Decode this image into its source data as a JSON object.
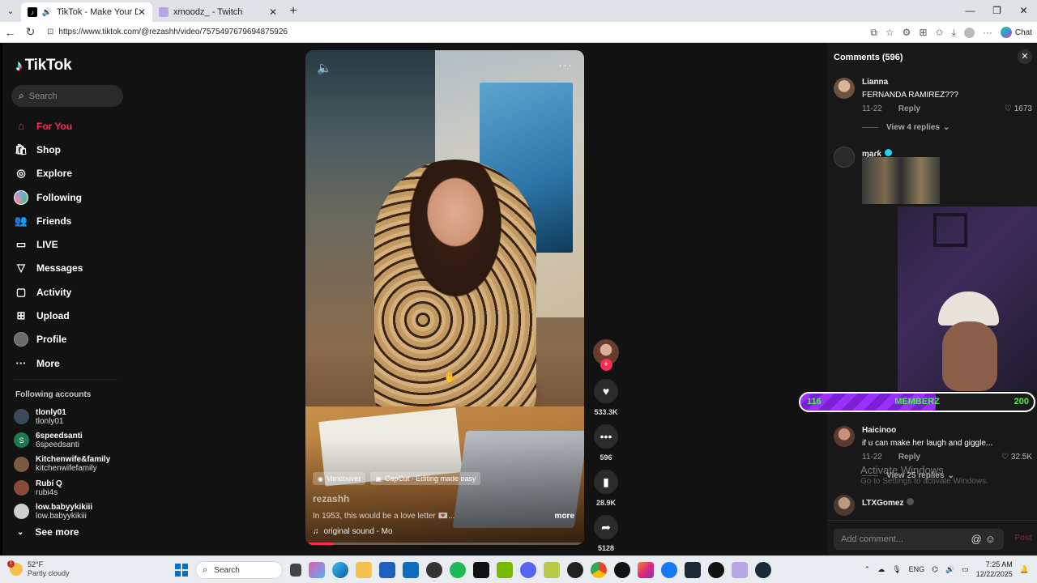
{
  "browser": {
    "tabs": [
      {
        "title": "TikTok - Make Your Day",
        "active": true
      },
      {
        "title": "xmoodz_ - Twitch",
        "active": false
      }
    ],
    "url": "https://www.tiktok.com/@rezashh/video/7575497679694875926",
    "chat_label": "Chat"
  },
  "sidebar": {
    "logo": "TikTok",
    "search_placeholder": "Search",
    "nav": [
      {
        "label": "For You",
        "icon": "home-icon",
        "active": true
      },
      {
        "label": "Shop",
        "icon": "shop-icon"
      },
      {
        "label": "Explore",
        "icon": "compass-icon"
      },
      {
        "label": "Following",
        "icon": "following-avatar-icon"
      },
      {
        "label": "Friends",
        "icon": "friends-icon"
      },
      {
        "label": "LIVE",
        "icon": "live-icon"
      },
      {
        "label": "Messages",
        "icon": "messages-icon"
      },
      {
        "label": "Activity",
        "icon": "activity-icon"
      },
      {
        "label": "Upload",
        "icon": "upload-icon"
      },
      {
        "label": "Profile",
        "icon": "profile-avatar-icon"
      },
      {
        "label": "More",
        "icon": "more-icon"
      }
    ],
    "following_title": "Following accounts",
    "following": [
      {
        "name": "tlonly01",
        "handle": "tlonly01",
        "color": "#3b4a5a"
      },
      {
        "name": "6speedsanti",
        "handle": "6speedsanti",
        "color": "#1f7a4d",
        "initial": "S"
      },
      {
        "name": "Kitchenwife&family",
        "handle": "kitchenwifefamily",
        "color": "#7a5a44"
      },
      {
        "name": "Rubí Q",
        "handle": "rubi4s",
        "color": "#8a4a3a"
      },
      {
        "name": "low.babyykikiii",
        "handle": "low.babyykikiii",
        "color": "#cfcfcf"
      }
    ],
    "see_more": "See more"
  },
  "video": {
    "tags": [
      "Vancouver",
      "CapCut · Editing made easy"
    ],
    "username": "rezashh",
    "caption": "In 1953, this would be a love letter 💌...",
    "more_label": "more",
    "sound": "original sound - Mo",
    "progress": 0.1
  },
  "actions": {
    "likes": "533.3K",
    "comments": "596",
    "saves": "28.9K",
    "shares": "5128"
  },
  "comments": {
    "header": "Comments (596)",
    "items": [
      {
        "name": "Lianna",
        "text": "FERNANDA RAMIREZ???",
        "date": "11-22",
        "reply": "Reply",
        "likes": "1673",
        "replies": "View 4 replies"
      },
      {
        "name": "ɱąɾƙ",
        "verified": true
      },
      {
        "name": "Haicinoo",
        "text": "if u can make her laugh and giggle...",
        "date": "11-22",
        "reply": "Reply",
        "likes": "32.5K",
        "replies": "View 25 replies"
      },
      {
        "name": "LTXGomez"
      }
    ],
    "input_placeholder": "Add comment...",
    "post_label": "Post"
  },
  "overlay": {
    "goal_left": "116",
    "goal_label": "MEMBERZ",
    "goal_right": "200",
    "goal_progress": 0.58,
    "watermark_title": "Activate Windows",
    "watermark_sub": "Go to Settings to activate Windows."
  },
  "taskbar": {
    "weather_temp": "52°F",
    "weather_cond": "Partly cloudy",
    "weather_badge": "1",
    "search_label": "Search",
    "lang": "ENG",
    "time": "7:25 AM",
    "date": "12/22/2025"
  }
}
